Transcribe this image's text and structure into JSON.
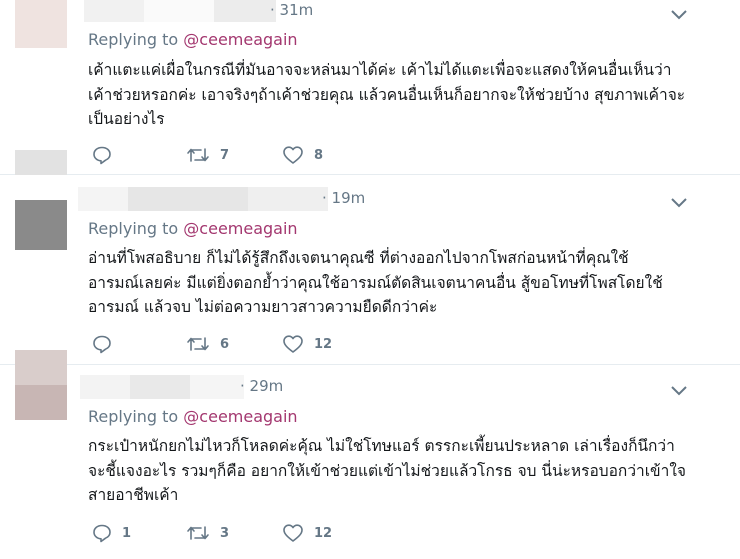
{
  "tweets": [
    {
      "time": "31m",
      "replying_prefix": "Replying to",
      "replying_handle": "@ceemeagain",
      "lines": [
        "เค้าแตะแค่เผื่อในกรณีที่มันอาจจะหล่นมาได้ค่ะ เค้าไม่ได้แตะเพื่อจะแสดงให้คนอื่นเห็นว่า",
        "เค้าช่วยหรอกค่ะ เอาจริงๆถ้าเค้าช่วยคุณ แล้วคนอื่นเห็นก็อยากจะให้ช่วยบ้าง สุขภาพเค้าจะ",
        "เป็นอย่างไร"
      ],
      "reply_count": "",
      "retweet_count": "7",
      "like_count": "8"
    },
    {
      "time": "19m",
      "replying_prefix": "Replying to",
      "replying_handle": "@ceemeagain",
      "lines": [
        "อ่านที่โพสอธิบาย ก็ไม่ได้รู้สึกถึงเจตนาคุณซี ที่ต่างออกไปจากโพสก่อนหน้าที่คุณใช้",
        "อารมณ์เลยค่ะ มีแต่ยิ่งตอกย้ำว่าคุณใช้อารมณ์ตัดสินเจตนาคนอื่น สู้ขอโทษที่โพสโดยใช้",
        "อารมณ์ แล้วจบ ไม่ต่อความยาวสาวความยืดดีกว่าค่ะ"
      ],
      "reply_count": "",
      "retweet_count": "6",
      "like_count": "12"
    },
    {
      "time": "29m",
      "replying_prefix": "Replying to",
      "replying_handle": "@ceemeagain",
      "lines": [
        "กระเป๋าหนักยกไม่ไหวก็โหลดค่ะคุ้ณ ไม่ใช่โทษแอร์ ตรรกะเพี้ยนประหลาด เล่าเรื่องก็นึกว่า",
        "จะชี้แจงอะไร รวมๆก็คือ อยากให้เข้าช่วยแต่เข้าไม่ช่วยแล้วโกรธ จบ นี่น่ะหรอบอกว่าเข้าใจ",
        "สายอาชีพเค้า"
      ],
      "reply_count": "1",
      "retweet_count": "3",
      "like_count": "12"
    }
  ],
  "icons": {
    "reply": "reply-icon",
    "retweet": "retweet-icon",
    "like": "heart-icon",
    "caret": "chevron-down-icon"
  },
  "colors": {
    "meta_gray": "#657786",
    "handle_color": "#a3376f",
    "divider": "#e6ecf0"
  }
}
